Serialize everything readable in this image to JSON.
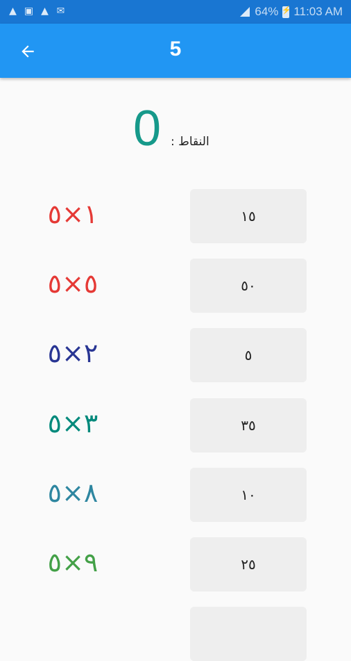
{
  "status_bar": {
    "left_icons": [
      "warning-icon",
      "image-icon",
      "warning-icon",
      "message-icon"
    ],
    "battery": "64%",
    "time": "11:03 AM"
  },
  "app_bar": {
    "title": "5",
    "back_icon": "arrow-left-icon"
  },
  "score": {
    "value": "0",
    "label": "النقاط :"
  },
  "rows": [
    {
      "equation": "١×٥",
      "answer": "١٥",
      "color": "#e53935"
    },
    {
      "equation": "٥×٥",
      "answer": "٥٠",
      "color": "#e53935"
    },
    {
      "equation": "٢×٥",
      "answer": "٥",
      "color": "#283593"
    },
    {
      "equation": "٣×٥",
      "answer": "٣٥",
      "color": "#00897b"
    },
    {
      "equation": "٨×٥",
      "answer": "١٠",
      "color": "#2e86a0"
    },
    {
      "equation": "٩×٥",
      "answer": "٢٥",
      "color": "#43a047"
    },
    {
      "equation": "",
      "answer": "",
      "color": "#e53935"
    }
  ],
  "colors": {
    "status_bar": "#1976d2",
    "app_bar": "#2196f3",
    "score": "#16998a",
    "button_bg": "#eeeeee"
  }
}
